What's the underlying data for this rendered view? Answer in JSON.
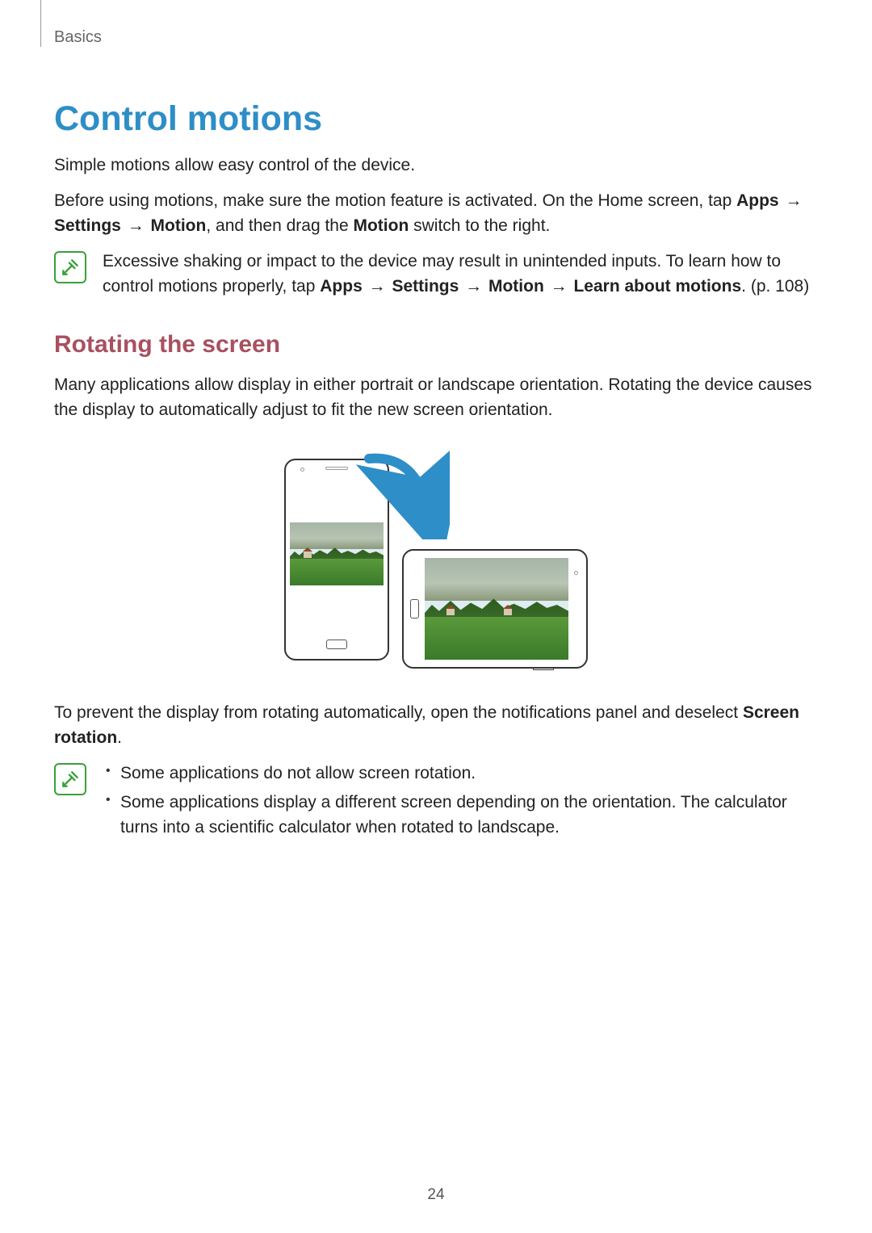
{
  "header": {
    "section": "Basics"
  },
  "title": "Control motions",
  "intro1": "Simple motions allow easy control of the device.",
  "intro2_a": "Before using motions, make sure the motion feature is activated. On the Home screen, tap ",
  "intro2_path_apps": "Apps",
  "intro2_path_settings": "Settings",
  "intro2_path_motion": "Motion",
  "intro2_b": ", and then drag the ",
  "intro2_switch": "Motion",
  "intro2_c": " switch to the right.",
  "note1_a": "Excessive shaking or impact to the device may result in unintended inputs. To learn how to control motions properly, tap ",
  "note1_path_apps": "Apps",
  "note1_path_settings": "Settings",
  "note1_path_motion": "Motion",
  "note1_path_learn": "Learn about motions",
  "note1_b": ". (p. 108)",
  "subtitle": "Rotating the screen",
  "rotate_p1": "Many applications allow display in either portrait or landscape orientation. Rotating the device causes the display to automatically adjust to fit the new screen orientation.",
  "rotate_p2_a": "To prevent the display from rotating automatically, open the notifications panel and deselect ",
  "rotate_p2_b": "Screen rotation",
  "rotate_p2_c": ".",
  "note2_bullet1": "Some applications do not allow screen rotation.",
  "note2_bullet2": "Some applications display a different screen depending on the orientation. The calculator turns into a scientific calculator when rotated to landscape.",
  "arrow": "→",
  "page": "24"
}
